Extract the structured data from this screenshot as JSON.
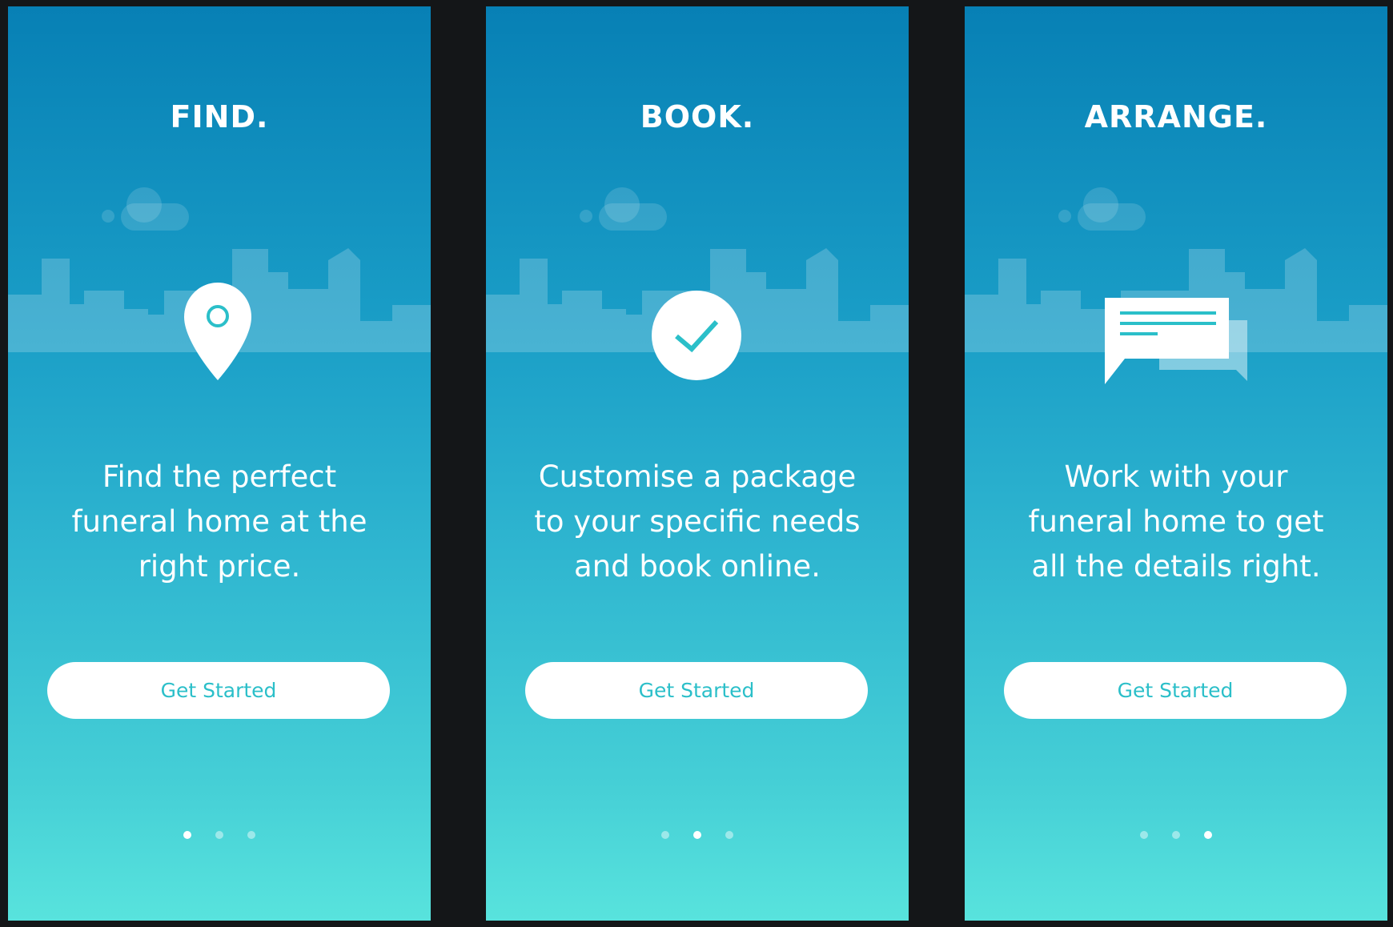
{
  "colors": {
    "gradient_top": "#0780b5",
    "gradient_bottom": "#58e3dd",
    "accent": "#2bbfc9",
    "button_bg": "#ffffff",
    "background": "#141618"
  },
  "screens": [
    {
      "title": "FIND.",
      "icon": "map-pin-icon",
      "lines": [
        "Find the perfect",
        "funeral home at the",
        "right price."
      ],
      "button_label": "Get Started",
      "page_index": 0,
      "page_count": 3
    },
    {
      "title": "BOOK.",
      "icon": "checkmark-circle-icon",
      "lines": [
        "Customise a package",
        "to your specific needs",
        "and book online."
      ],
      "button_label": "Get Started",
      "page_index": 1,
      "page_count": 3
    },
    {
      "title": "ARRANGE.",
      "icon": "chat-bubbles-icon",
      "lines": [
        "Work with your",
        "funeral home to get",
        "all the details right."
      ],
      "button_label": "Get Started",
      "page_index": 2,
      "page_count": 3
    }
  ]
}
